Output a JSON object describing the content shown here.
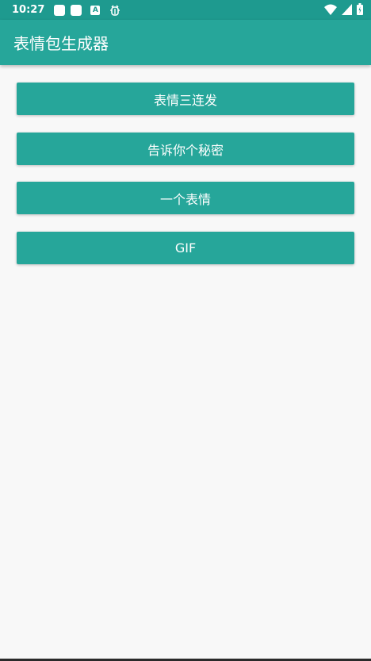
{
  "status_bar": {
    "time": "10:27",
    "notification_icons": [
      "app-notification-icon",
      "app-notification-icon",
      "a-badge-icon",
      "bug-icon"
    ],
    "system_icons": [
      "wifi-icon",
      "signal-icon",
      "battery-icon"
    ],
    "badge_letter": "A"
  },
  "app_bar": {
    "title": "表情包生成器"
  },
  "buttons": [
    {
      "label": "表情三连发"
    },
    {
      "label": "告诉你个秘密"
    },
    {
      "label": "一个表情"
    },
    {
      "label": "GIF"
    }
  ],
  "colors": {
    "primary": "#26a69a",
    "primary_dark": "#1e9a8f",
    "background": "#f8f8f8"
  }
}
